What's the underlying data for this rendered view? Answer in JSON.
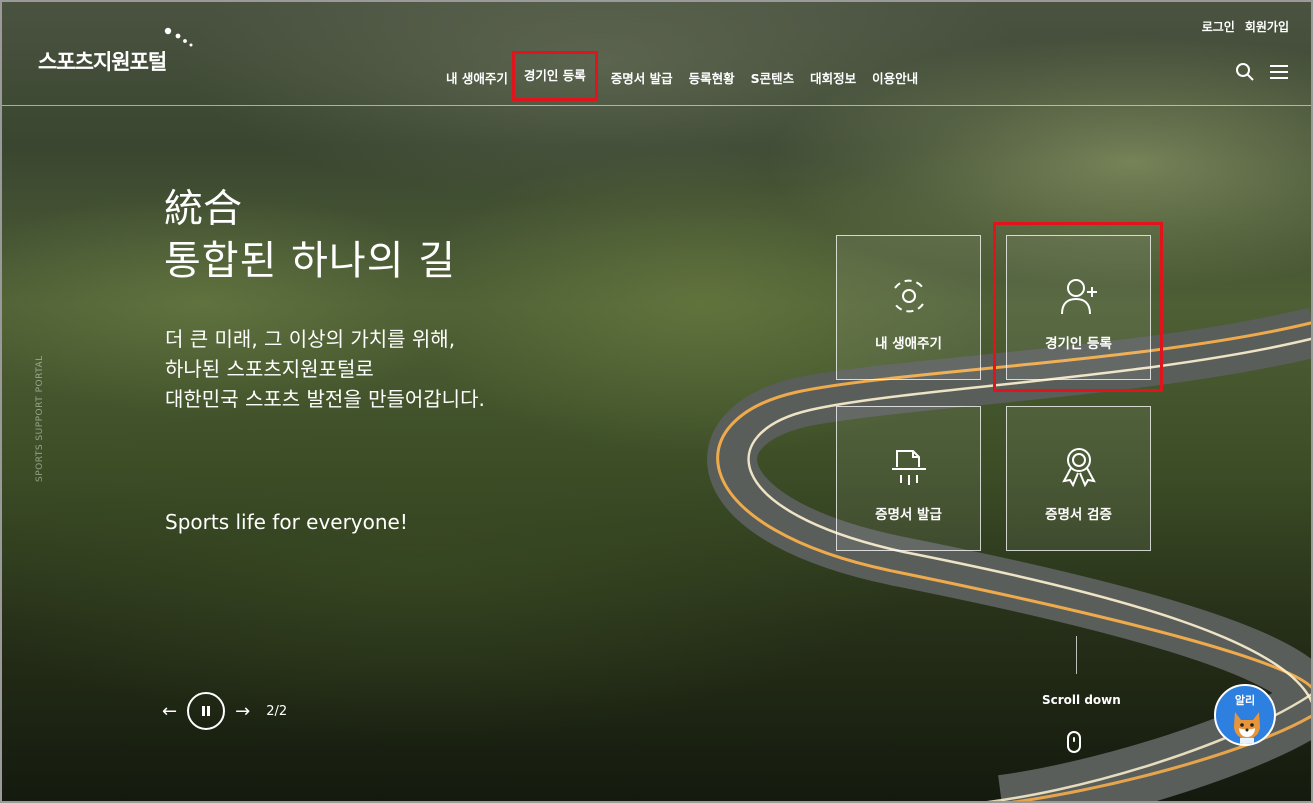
{
  "header": {
    "logo_text": "스포츠지원포털",
    "login": "로그인",
    "signup": "회원가입",
    "nav": [
      "내 생애주기",
      "경기인 등록",
      "증명서 발급",
      "등록현황",
      "S콘텐츠",
      "대회정보",
      "이용안내"
    ],
    "highlighted_nav_index": 1
  },
  "hero": {
    "side_text": "SPORTS SUPPORT PORTAL",
    "hanja": "統合",
    "title": "통합된 하나의 길",
    "desc_lines": [
      "더 큰 미래, 그 이상의 가치를 위해,",
      "하나된 스포츠지원포털로",
      "대한민국 스포츠 발전을 만들어갑니다."
    ],
    "slogan": "Sports life for everyone!"
  },
  "tiles": [
    {
      "label": "내 생애주기",
      "icon": "lifecycle-icon"
    },
    {
      "label": "경기인 등록",
      "icon": "user-add-icon",
      "highlighted": true
    },
    {
      "label": "증명서 발급",
      "icon": "certificate-print-icon"
    },
    {
      "label": "증명서 검증",
      "icon": "award-icon"
    }
  ],
  "slider": {
    "counter": "2/2"
  },
  "scroll": {
    "label": "Scroll down"
  },
  "chatbot": {
    "label": "알리"
  },
  "colors": {
    "highlight": "#e1141b",
    "chatbot": "#2d7fe0"
  }
}
